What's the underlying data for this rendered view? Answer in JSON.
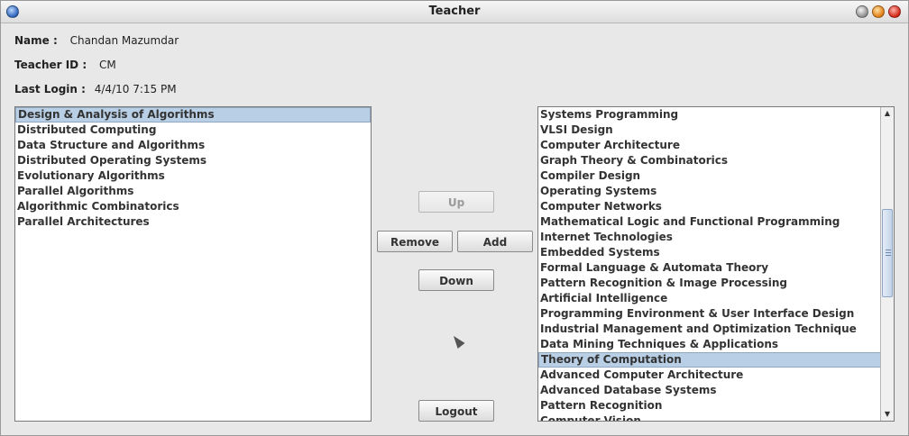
{
  "window": {
    "title": "Teacher"
  },
  "info": {
    "name_label": "Name :",
    "name_value": "Chandan Mazumdar",
    "id_label": "Teacher ID :",
    "id_value": "CM",
    "login_label": "Last Login :",
    "login_value": "4/4/10 7:15 PM"
  },
  "assigned_courses": [
    {
      "label": "Design & Analysis of Algorithms",
      "selected": true
    },
    {
      "label": "Distributed Computing"
    },
    {
      "label": "Data Structure and Algorithms"
    },
    {
      "label": "Distributed Operating Systems"
    },
    {
      "label": "Evolutionary Algorithms"
    },
    {
      "label": "Parallel Algorithms"
    },
    {
      "label": "Algorithmic Combinatorics"
    },
    {
      "label": "Parallel Architectures"
    }
  ],
  "available_courses": [
    {
      "label": "Systems Programming"
    },
    {
      "label": "VLSI Design"
    },
    {
      "label": "Computer Architecture"
    },
    {
      "label": "Graph Theory & Combinatorics"
    },
    {
      "label": "Compiler Design"
    },
    {
      "label": "Operating Systems"
    },
    {
      "label": "Computer Networks"
    },
    {
      "label": "Mathematical Logic and Functional Programming"
    },
    {
      "label": "Internet Technologies"
    },
    {
      "label": "Embedded Systems"
    },
    {
      "label": "Formal Language & Automata Theory"
    },
    {
      "label": "Pattern Recognition & Image Processing"
    },
    {
      "label": "Artificial Intelligence"
    },
    {
      "label": "Programming Environment & User Interface Design"
    },
    {
      "label": "Industrial Management and Optimization Technique"
    },
    {
      "label": "Data Mining Techniques & Applications"
    },
    {
      "label": "Theory of Computation",
      "selected": true
    },
    {
      "label": "Advanced Computer Architecture"
    },
    {
      "label": "Advanced Database Systems"
    },
    {
      "label": "Pattern Recognition"
    },
    {
      "label": "Computer Vision"
    }
  ],
  "buttons": {
    "up": "Up",
    "remove": "Remove",
    "add": "Add",
    "down": "Down",
    "logout": "Logout"
  },
  "icons": {
    "window_menu": "window-menu-icon",
    "minimize": "minimize-icon",
    "maximize": "maximize-icon",
    "close": "close-icon",
    "scroll_up": "scroll-up-arrow-icon",
    "scroll_down": "scroll-down-arrow-icon"
  },
  "colors": {
    "selection": "#b8cfe5",
    "close": "#d02414",
    "maximize": "#e07b12"
  }
}
